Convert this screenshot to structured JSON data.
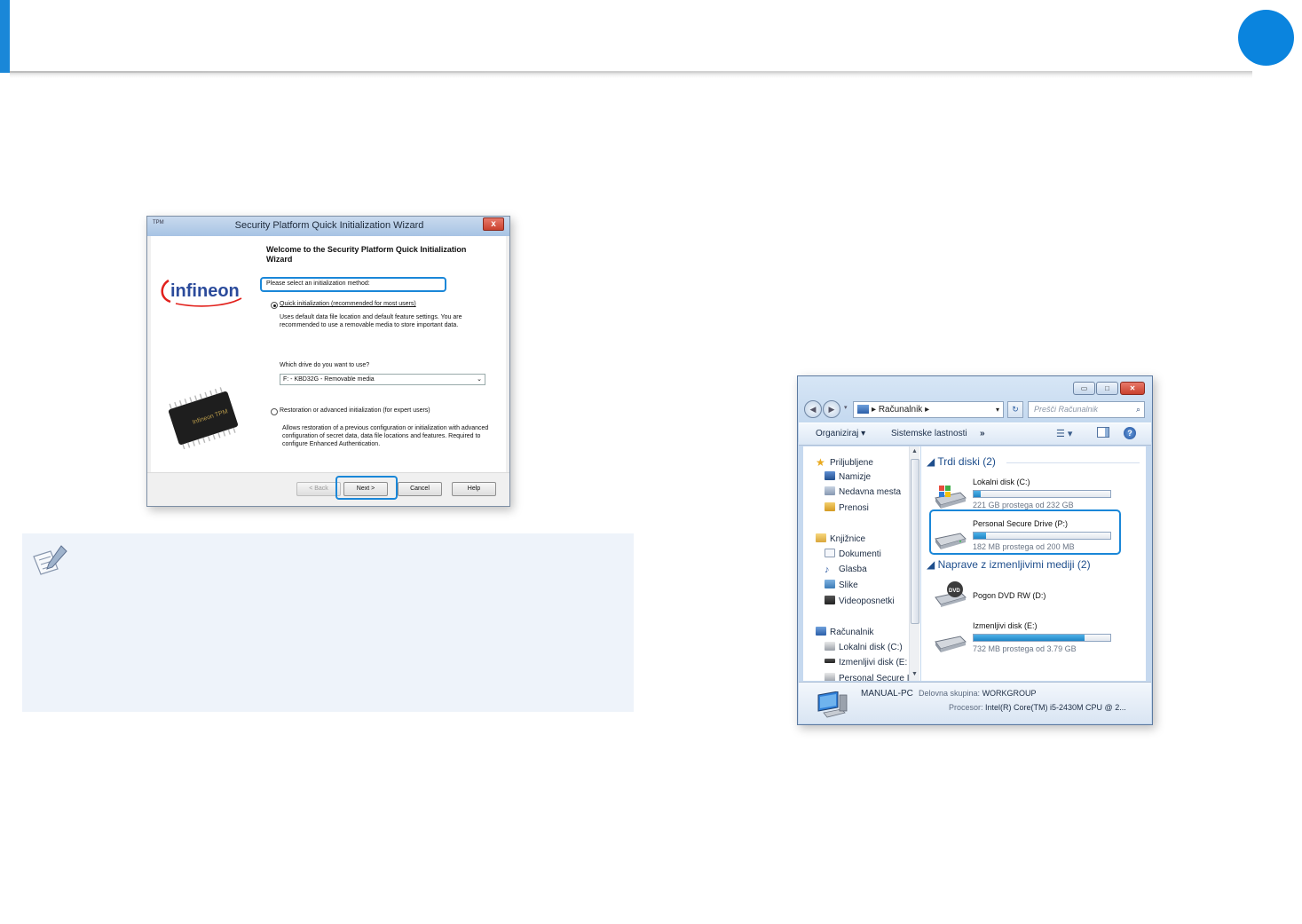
{
  "wizard": {
    "title": "Security Platform Quick Initialization Wizard",
    "app_icon_text": "TPM",
    "close_glyph": "x",
    "logo_text": "infineon",
    "chip_text": "Infineon TPM",
    "heading": "Welcome to the Security Platform Quick Initialization Wizard",
    "prompt": "Please select an initialization method:",
    "option_quick": {
      "label": "Quick initialization (recommended for most users)",
      "selected": true,
      "description": "Uses default data file location and default feature settings. You are recommended to use a removable media to store important data."
    },
    "drive_question": "Which drive do you want to use?",
    "drive_value": "F: - KBD32G - Removable media",
    "option_advanced": {
      "label": "Restoration or advanced initialization (for expert users)",
      "selected": false,
      "description": "Allows restoration of a previous configuration or initialization with advanced configuration of secret data, data file locations and features. Required to configure Enhanced Authentication."
    },
    "buttons": {
      "back": "< Back",
      "next": "Next >",
      "cancel": "Cancel",
      "help": "Help"
    }
  },
  "explorer": {
    "address": "Računalnik",
    "search_placeholder": "Prešči Računalnik",
    "toolbar": {
      "organize": "Organiziraj ▾",
      "system_properties": "Sistemske lastnosti",
      "more": "»"
    },
    "nav": {
      "favorites": "Priljubljene",
      "desktop": "Namizje",
      "recent": "Nedavna mesta",
      "downloads": "Prenosi",
      "libraries": "Knjižnice",
      "documents": "Dokumenti",
      "music": "Glasba",
      "pictures": "Slike",
      "videos": "Videoposnetki",
      "computer": "Računalnik",
      "local_c": "Lokalni disk (C:)",
      "removable_e": "Izmenljivi disk (E:",
      "personal_secure": "Personal Secure I"
    },
    "groups": {
      "hard_disks": "Trdi diski (2)",
      "removable": "Naprave z izmenljivimi mediji (2)"
    },
    "drives": [
      {
        "name": "Lokalni disk (C:)",
        "free": "221 GB prostega od 232 GB",
        "used_fraction": 0.05
      },
      {
        "name": "Personal Secure Drive (P:)",
        "free": "182 MB prostega od 200 MB",
        "used_fraction": 0.09
      },
      {
        "name": "Pogon DVD RW (D:)",
        "free": "",
        "used_fraction": null
      },
      {
        "name": "Izmenljivi disk (E:)",
        "free": "732 MB prostega od 3.79 GB",
        "used_fraction": 0.81
      }
    ],
    "details": {
      "computer_name": "MANUAL-PC",
      "workgroup_label": "Delovna skupina:",
      "workgroup_value": "WORKGROUP",
      "cpu_label": "Procesor:",
      "cpu_value": "Intel(R) Core(TM) i5-2430M CPU @ 2..."
    }
  },
  "colors": {
    "accent": "#1a87d8",
    "page_circle": "#0a84de",
    "note_background": "#eef3fa"
  }
}
